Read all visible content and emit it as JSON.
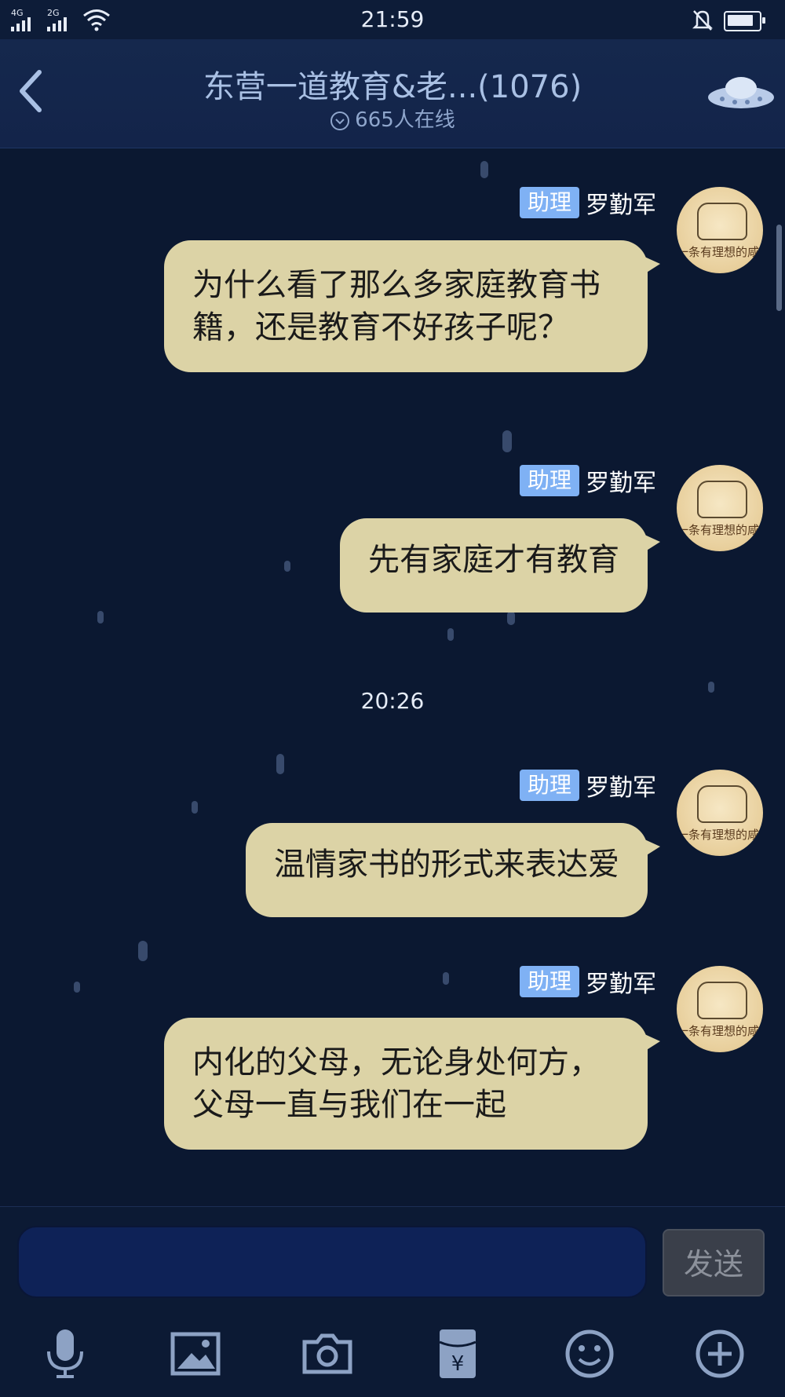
{
  "status": {
    "net1": "4G",
    "net2": "2G",
    "time": "21:59",
    "battery_level": 0.85
  },
  "header": {
    "title": "东营一道教育&老...(1076)",
    "online": "665人在线"
  },
  "messages": [
    {
      "tag": "助理",
      "sender": "罗勤军",
      "avatar_caption": "一条有理想的咸鱼",
      "text": "为什么看了那么多家庭教育书籍，还是教育不好孩子呢？"
    },
    {
      "tag": "助理",
      "sender": "罗勤军",
      "avatar_caption": "一条有理想的咸鱼",
      "text": "先有家庭才有教育"
    },
    {
      "tag": "助理",
      "sender": "罗勤军",
      "avatar_caption": "一条有理想的咸鱼",
      "text": "温情家书的形式来表达爱"
    },
    {
      "tag": "助理",
      "sender": "罗勤军",
      "avatar_caption": "一条有理想的咸鱼",
      "text": "内化的父母，无论身处何方，父母一直与我们在一起"
    }
  ],
  "timestamp": "20:26",
  "input": {
    "value": "",
    "send_label": "发送"
  },
  "toolbar": [
    "mic-icon",
    "image-icon",
    "camera-icon",
    "red-packet-icon",
    "emoji-icon",
    "plus-icon"
  ],
  "colors": {
    "background": "#0b1831",
    "bubble": "#dcd3a6",
    "tag": "#7fb1f4",
    "header": "#15284d"
  }
}
